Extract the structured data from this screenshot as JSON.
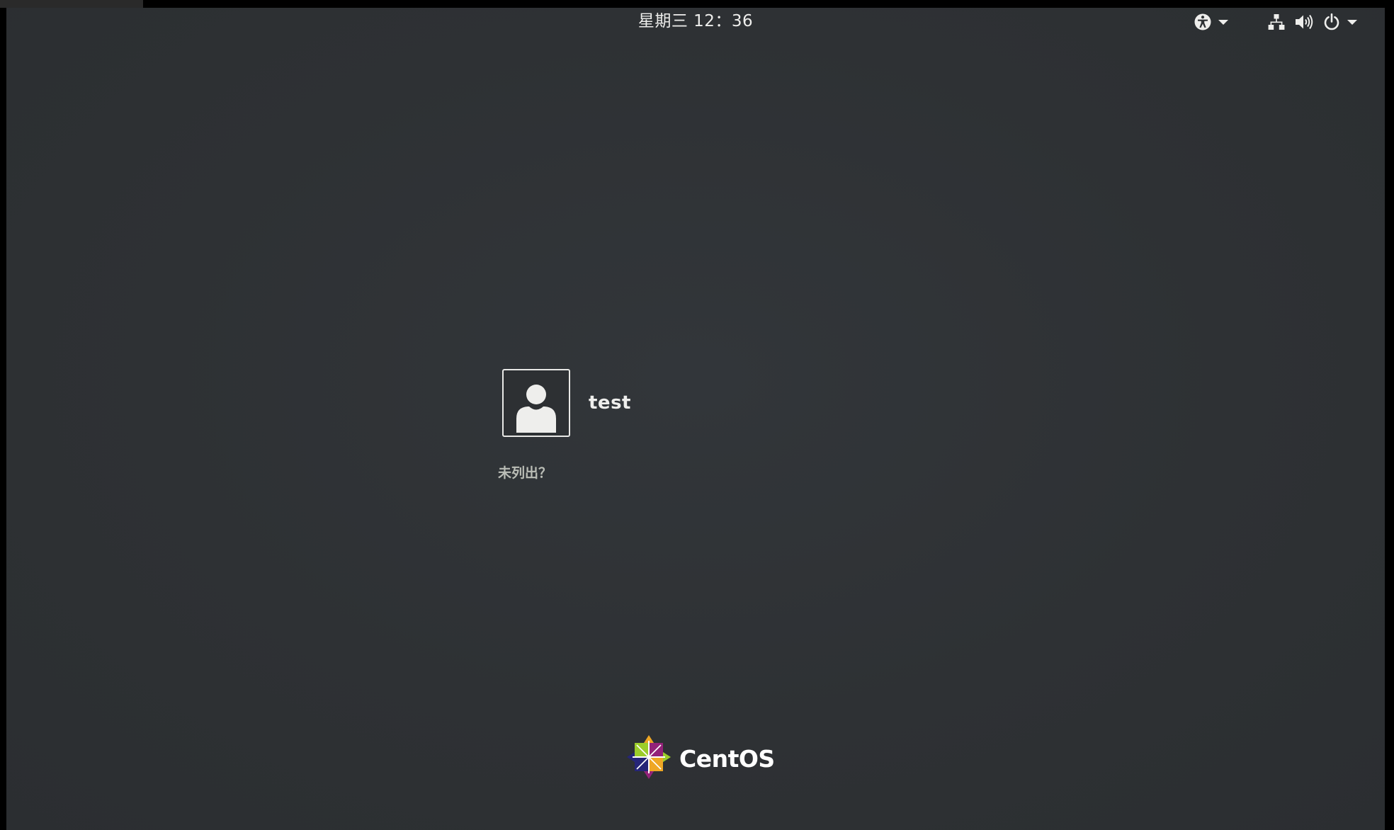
{
  "top_bar": {
    "clock": "星期三 12：36",
    "icons": {
      "accessibility": "accessibility-icon",
      "network": "network-wired-icon",
      "volume": "volume-icon",
      "power": "power-icon",
      "dropdown": "chevron-down-icon"
    }
  },
  "users": [
    {
      "name": "test",
      "avatar": "user-avatar-icon"
    }
  ],
  "login": {
    "not_listed": "未列出？"
  },
  "branding": {
    "logo_text": "CentOS",
    "logo_icon": "centos-logo-icon"
  },
  "colors": {
    "background": "#2e3134",
    "text": "#eeeeec",
    "secondary_text": "#babdb6",
    "logo_green": "#9ccd2a",
    "logo_purple": "#932279",
    "logo_orange": "#efa724",
    "logo_blue": "#262577"
  }
}
